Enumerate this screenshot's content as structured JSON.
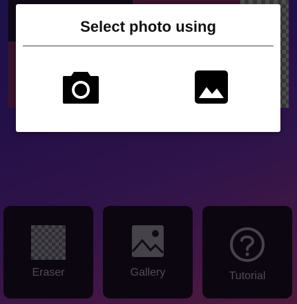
{
  "dialog": {
    "title": "Select photo using",
    "options": [
      {
        "name": "camera",
        "icon": "camera-icon"
      },
      {
        "name": "gallery",
        "icon": "image-icon"
      }
    ]
  },
  "tiles": [
    {
      "label": "Eraser",
      "icon": "transparent-checker-icon"
    },
    {
      "label": "Gallery",
      "icon": "gallery-image-icon"
    },
    {
      "label": "Tutorial",
      "icon": "help-circle-icon"
    }
  ],
  "colors": {
    "dialog_bg": "#ffffff",
    "tile_bg": "#130a1a",
    "tile_text": "#7b7680",
    "background_start": "#2b1b6f",
    "background_end": "#7a2a5a"
  }
}
